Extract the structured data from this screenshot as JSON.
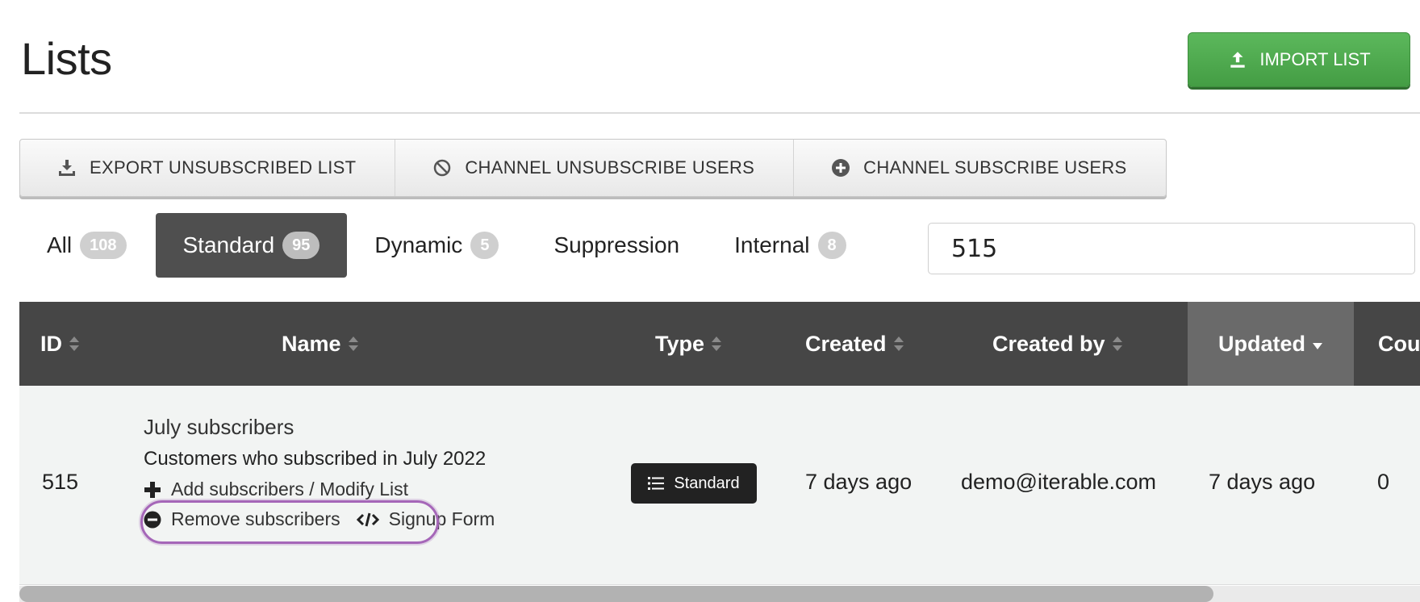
{
  "header": {
    "title": "Lists",
    "import_label": "IMPORT LIST"
  },
  "actions": [
    {
      "label": "EXPORT UNSUBSCRIBED LIST",
      "icon": "download-icon"
    },
    {
      "label": "CHANNEL UNSUBSCRIBE USERS",
      "icon": "ban-icon"
    },
    {
      "label": "CHANNEL SUBSCRIBE USERS",
      "icon": "plus-circle-icon"
    }
  ],
  "tabs": [
    {
      "label": "All",
      "count": "108"
    },
    {
      "label": "Standard",
      "count": "95",
      "active": true
    },
    {
      "label": "Dynamic",
      "count": "5"
    },
    {
      "label": "Suppression"
    },
    {
      "label": "Internal",
      "count": "8"
    }
  ],
  "search": {
    "value": "515"
  },
  "table": {
    "columns": {
      "id": "ID",
      "name": "Name",
      "type": "Type",
      "created": "Created",
      "created_by": "Created by",
      "updated": "Updated",
      "count": "Cou"
    },
    "rows": [
      {
        "id": "515",
        "name": "July subscribers",
        "description": "Customers who subscribed in July 2022",
        "add_action": "Add subscribers / Modify List",
        "remove_action": "Remove subscribers",
        "signup_action": "Signup Form",
        "type": "Standard",
        "created": "7 days ago",
        "created_by": "demo@iterable.com",
        "updated": "7 days ago",
        "count": "0"
      }
    ]
  },
  "colors": {
    "import_button": "#5cb85c",
    "header_bg": "#464646",
    "highlight_ring": "#a566b8"
  },
  "scroll": {
    "thumb_fraction": 0.85
  }
}
